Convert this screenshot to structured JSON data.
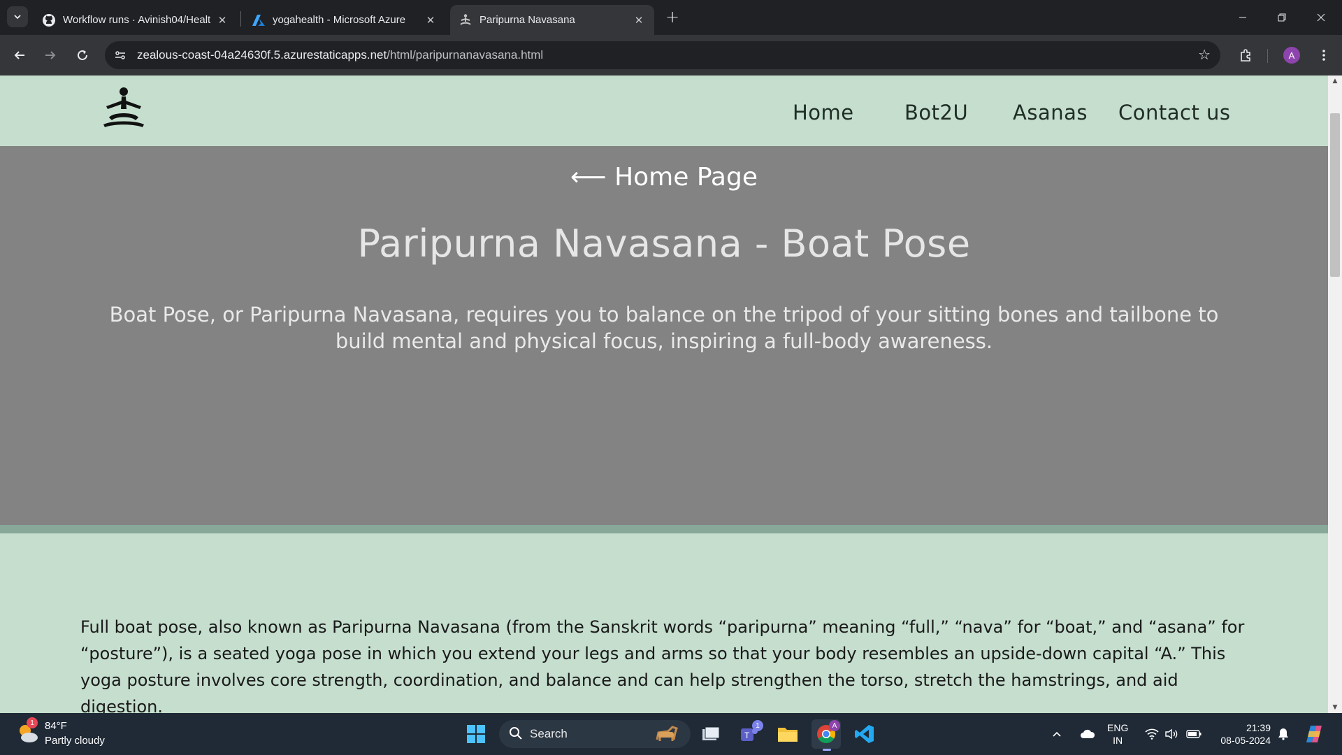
{
  "browser": {
    "tabs": [
      {
        "title": "Workflow runs · Avinish04/Healt",
        "icon": "github-icon"
      },
      {
        "title": "yogahealth - Microsoft Azure",
        "icon": "azure-icon"
      },
      {
        "title": "Paripurna Navasana",
        "icon": "yoga-icon",
        "active": true
      }
    ],
    "url_host": "zealous-coast-04a24630f.5.azurestaticapps.net",
    "url_path": "/html/paripurnanavasana.html",
    "profile_initial": "A"
  },
  "site": {
    "nav": {
      "home": "Home",
      "bot": "Bot2U",
      "asanas": "Asanas",
      "contact": "Contact us"
    },
    "back_link": "⟵ Home Page",
    "title": "Paripurna Navasana - Boat Pose",
    "description": "Boat Pose, or Paripurna Navasana, requires you to balance on the tripod of your sitting bones and tailbone to build mental and physical focus, inspiring a full-body awareness.",
    "paragraph": "Full boat pose, also known as Paripurna Navasana (from the Sanskrit words “paripurna” meaning “full,” “nava” for “boat,” and “asana” for “posture”), is a seated yoga pose in which you extend your legs and arms so that your body resembles an upside-down capital “A.” This yoga posture involves core strength, coordination, and balance and can help strengthen the torso, stretch the hamstrings, and aid digestion."
  },
  "taskbar": {
    "weather_temp": "84°F",
    "weather_cond": "Partly cloudy",
    "weather_badge": "1",
    "search_label": "Search",
    "teams_badge": "1",
    "lang_line1": "ENG",
    "lang_line2": "IN",
    "time": "21:39",
    "date": "08-05-2024"
  },
  "colors": {
    "page_bg": "#c5dece",
    "hero_bg": "#838383",
    "band": "#88a89a",
    "taskbar": "#1f2a36"
  }
}
